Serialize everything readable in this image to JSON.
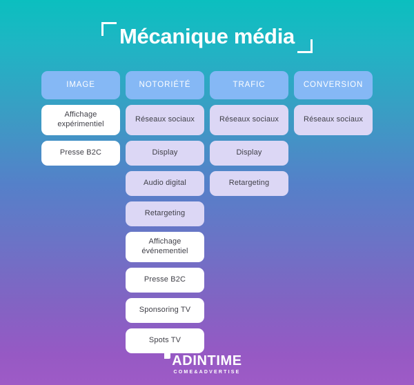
{
  "page": {
    "title": "Mécanique média",
    "bracket_left": "corner-bracket-top-left",
    "bracket_right": "corner-bracket-bottom-right",
    "background_gradient_start": "#0BBFBF",
    "background_gradient_end": "#9E5BC6"
  },
  "colors": {
    "header_cell": "#85B8F5",
    "header_text": "#FFFFFF",
    "lavender_cell": "#DCD7F5",
    "white_cell": "#FFFFFF",
    "cell_text": "#3E3E46"
  },
  "columns": [
    {
      "header": "IMAGE",
      "items": [
        {
          "label": "Affichage expérimentiel",
          "style": "white",
          "lines": 2
        },
        {
          "label": "Presse B2C",
          "style": "white",
          "lines": 1
        }
      ]
    },
    {
      "header": "NOTORIÉTÉ",
      "items": [
        {
          "label": "Réseaux sociaux",
          "style": "lavender",
          "lines": 2
        },
        {
          "label": "Display",
          "style": "lavender",
          "lines": 1
        },
        {
          "label": "Audio digital",
          "style": "lavender",
          "lines": 1
        },
        {
          "label": "Retargeting",
          "style": "lavender",
          "lines": 1
        },
        {
          "label": "Affichage événementiel",
          "style": "white",
          "lines": 2
        },
        {
          "label": "Presse B2C",
          "style": "white",
          "lines": 1
        },
        {
          "label": "Sponsoring TV",
          "style": "white",
          "lines": 1
        },
        {
          "label": "Spots TV",
          "style": "white",
          "lines": 1
        }
      ]
    },
    {
      "header": "TRAFIC",
      "items": [
        {
          "label": "Réseaux sociaux",
          "style": "lavender",
          "lines": 2
        },
        {
          "label": "Display",
          "style": "lavender",
          "lines": 1
        },
        {
          "label": "Retargeting",
          "style": "lavender",
          "lines": 1
        }
      ]
    },
    {
      "header": "CONVERSION",
      "items": [
        {
          "label": "Réseaux sociaux",
          "style": "lavender",
          "lines": 2
        }
      ]
    }
  ],
  "footer": {
    "logo_name": "ADINTIME",
    "logo_tagline": "COME&ADVERTISE",
    "logo_mark": "square-mark"
  }
}
